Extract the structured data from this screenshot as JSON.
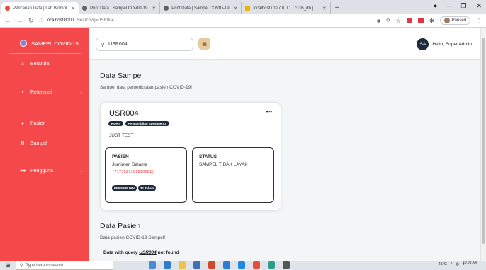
{
  "browser": {
    "tabs": [
      {
        "label": "Pencarian Data | Lab Biomol",
        "active": true,
        "fav": "red"
      },
      {
        "label": "Print Data | Sampel COVID-19",
        "active": false,
        "fav": "gray"
      },
      {
        "label": "Print Data | Sampel COVID-19",
        "active": false,
        "fav": "gray"
      },
      {
        "label": "localhost / 127.0.0.1 / c19s_db | ...",
        "active": false,
        "fav": "yellow"
      }
    ],
    "new_tab": "+",
    "url_host": "localhost:8000",
    "url_path": "/search?q=USR004",
    "paused_label": "Paused",
    "min_glyph": "–",
    "max_glyph": "❐",
    "close_glyph": "✕"
  },
  "sidebar": {
    "brand": "SAMPEL COVID-19",
    "items": [
      {
        "label": "Beranda",
        "icon": "home-icon",
        "glyph": "⌂"
      },
      {
        "label": "Referensi",
        "icon": "database-icon",
        "glyph": "▪",
        "chevron": "›"
      },
      {
        "label": "Pasien",
        "icon": "user-icon",
        "glyph": "●"
      },
      {
        "label": "Sampel",
        "icon": "flask-icon",
        "glyph": "Ⅲ"
      },
      {
        "label": "Pengguna",
        "icon": "users-icon",
        "glyph": "●●",
        "chevron": "›"
      }
    ]
  },
  "topnav": {
    "search_value": "USR004",
    "search_icon_glyph": "⚲",
    "search_button_glyph": "▦",
    "avatar_initials": "SA",
    "greeting": "Hello, Super Admin"
  },
  "sampel": {
    "heading": "Data Sampel",
    "subheading": "Sampel data pemeriksaan pasien COVID-19!",
    "card": {
      "code": "USR004",
      "menu_glyph": "•••",
      "badges": [
        "KDRT",
        "Pengambilan Spesimen 3"
      ],
      "note": "JUST TEST",
      "patient_label": "PASIEN",
      "patient_name": "Juminten Salama",
      "patient_nik": "(7173021301890001)",
      "patient_tags": [
        "PEREMPUAN",
        "32 Tahun"
      ],
      "status_label": "STATUS",
      "status_value": "SAMPEL TIDAK LAYAK"
    }
  },
  "pasien": {
    "heading": "Data Pasien",
    "subheading": "Data pasien COVID-19 Sampel!",
    "query_prefix": "Data with query",
    "query_value": "USR004",
    "query_suffix": "not found"
  },
  "taskbar": {
    "search_placeholder": "Type here to search",
    "temperature": "25°C",
    "time": "10:08 AM"
  },
  "colors": {
    "sidebar": "#f4484a",
    "badge": "#1f2b3a",
    "nik": "#e0454a"
  }
}
